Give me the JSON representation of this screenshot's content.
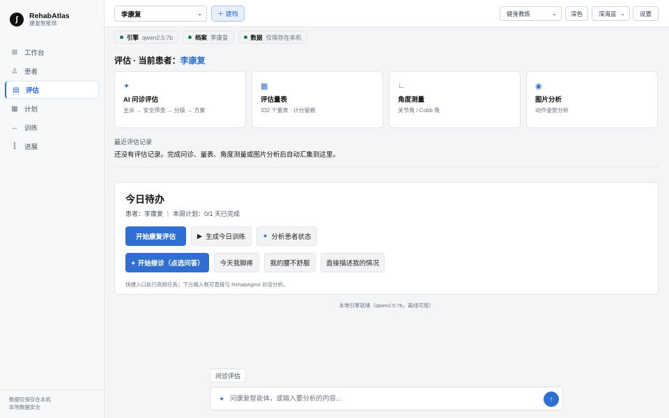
{
  "brand": {
    "logo_glyph": "ʃ",
    "name": "RehabAtlas",
    "subtitle": "康复智能体"
  },
  "sidebar": {
    "items": [
      {
        "label": "工作台",
        "icon": "grid-icon",
        "glyph": "⊞"
      },
      {
        "label": "患者",
        "icon": "person-icon",
        "glyph": "♙"
      },
      {
        "label": "评估",
        "icon": "document-icon",
        "glyph": "▤",
        "active": true
      },
      {
        "label": "计划",
        "icon": "calendar-icon",
        "glyph": "▦"
      },
      {
        "label": "训练",
        "icon": "arrows-icon",
        "glyph": "↔"
      },
      {
        "label": "进展",
        "icon": "bar-chart-icon",
        "glyph": "⫿"
      }
    ],
    "footer_line1": "数据仅保存在本机",
    "footer_line2": "本地数据安全"
  },
  "topbar": {
    "patient_selected": "李康复",
    "new_file_label": "＋ 建档",
    "role_selected": "健身教练",
    "dark_label": "深色",
    "theme_selected": "深海蓝",
    "settings_label": "设置"
  },
  "status_chips": [
    {
      "key": "引擎",
      "value": "qwen2.5:7b"
    },
    {
      "key": "档案",
      "value": "李康复"
    },
    {
      "key": "数据",
      "value": "仅保存在本机"
    }
  ],
  "section": {
    "title_prefix": "评估 · 当前患者：",
    "patient": "李康复"
  },
  "cards": [
    {
      "icon": "sparkle-icon",
      "glyph": "✦",
      "title": "AI 问诊评估",
      "desc": "主诉 → 安全筛查 → 分级 → 方案"
    },
    {
      "icon": "table-icon",
      "glyph": "▦",
      "title": "评估量表",
      "desc": "332 个量表 · 计分留痕"
    },
    {
      "icon": "angle-icon",
      "glyph": "∟",
      "title": "角度测量",
      "desc": "关节角 / Cobb 角"
    },
    {
      "icon": "target-icon",
      "glyph": "◉",
      "title": "图片分析",
      "desc": "动作姿势分析"
    }
  ],
  "recent": {
    "label": "最近评估记录",
    "empty_text": "还没有评估记录。完成问诊、量表、角度测量或图片分析后自动汇集到这里。"
  },
  "todo": {
    "title": "今日待办",
    "meta": "患者：李康复 ｜ 本周计划：0/1 天已完成",
    "primary_action": "开始康复评估",
    "action_generate": "生成今日训练",
    "action_analyze": "分析患者状态",
    "intake_button": "✦ 开始接诊（点选问答）",
    "quick_replies": [
      "今天我脚疼",
      "我的腰不舒服",
      "直接描述我的情况"
    ],
    "hint": "快捷入口执行高频任务；下方输入框可直接与 RehabAgent 对话分析。"
  },
  "engine_status": "本地引擎就绪（qwen2.5:7b，离线可用）",
  "composer": {
    "mode_tag": "问诊评估",
    "placeholder": "问康复智能体，或输入要分析的内容...",
    "send_glyph": "↑"
  },
  "colors": {
    "accent": "#2f6fd1",
    "status_dot": "#1f7a4d"
  }
}
